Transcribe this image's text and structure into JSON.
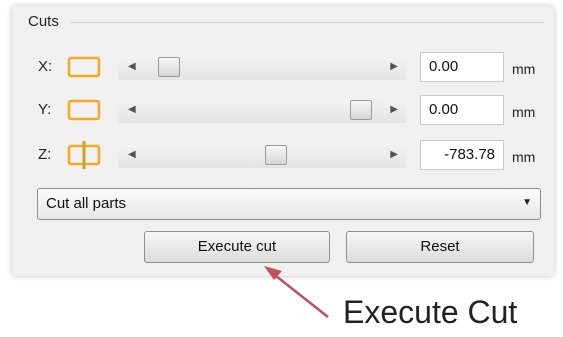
{
  "panel": {
    "title": "Cuts",
    "rows": [
      {
        "label": "X:",
        "value": "0.00",
        "unit": "mm",
        "thumb_position": 0.08
      },
      {
        "label": "Y:",
        "value": "0.00",
        "unit": "mm",
        "thumb_position": 0.92
      },
      {
        "label": "Z:",
        "value": "-783.78",
        "unit": "mm",
        "thumb_position": 0.55
      }
    ],
    "dropdown": {
      "selected": "Cut all parts"
    },
    "buttons": {
      "execute": "Execute cut",
      "reset": "Reset"
    }
  },
  "annotation": {
    "text": "Execute Cut"
  },
  "colors": {
    "icon_orange": "#f5a623",
    "arrow_red": "#c0505f"
  }
}
